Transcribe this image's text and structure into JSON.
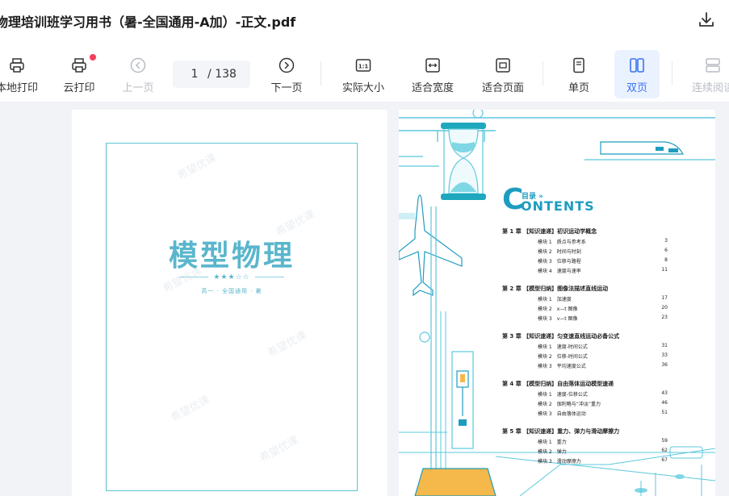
{
  "header": {
    "file_title": "物理培训班学习用书（暑-全国通用-A加）-正文.pdf",
    "download_icon": "download-icon"
  },
  "toolbar": {
    "local_print": "本地打印",
    "cloud_print": "云打印",
    "prev_page": "上一页",
    "current_page": "1",
    "total_pages": "/ 138",
    "next_page": "下一页",
    "actual_size": "实际大小",
    "fit_width": "适合宽度",
    "fit_page": "适合页面",
    "single_page": "单页",
    "double_page": "双页",
    "continuous": "连续阅读",
    "accent_color": "#3a73f0",
    "badge_color": "#f43e5a"
  },
  "cover": {
    "title": "模型物理",
    "stars": "★★★☆☆",
    "subtitle": "高一 · 全国通用 · 暑",
    "watermark": "希望优课"
  },
  "contents": {
    "big_letter": "C",
    "mulu": "目录 »",
    "word": "ONTENTS",
    "chapters": [
      {
        "title": "第 1 章 【知识速递】初识运动学概念",
        "modules": [
          {
            "name": "模块 1　质点与参考系",
            "page": "3"
          },
          {
            "name": "模块 2　时间与时刻",
            "page": "6"
          },
          {
            "name": "模块 3　位移与路程",
            "page": "8"
          },
          {
            "name": "模块 4　速度与速率",
            "page": "11"
          }
        ]
      },
      {
        "title": "第 2 章 【模型归纳】图像法描述直线运动",
        "modules": [
          {
            "name": "模块 1　加速度",
            "page": "17"
          },
          {
            "name": "模块 2　x—t 图像",
            "page": "20"
          },
          {
            "name": "模块 3　v—t 图像",
            "page": "23"
          }
        ]
      },
      {
        "title": "第 3 章 【知识速递】匀变速直线运动必备公式",
        "modules": [
          {
            "name": "模块 1　速度-时间公式",
            "page": "31"
          },
          {
            "name": "模块 2　位移-时间公式",
            "page": "33"
          },
          {
            "name": "模块 3　平均速度公式",
            "page": "36"
          }
        ]
      },
      {
        "title": "第 4 章 【模型归纳】自由落体运动模型速递",
        "modules": [
          {
            "name": "模块 1　速度-位移公式",
            "page": "43"
          },
          {
            "name": "模块 2　伽利略与“冲淡”重力",
            "page": "46"
          },
          {
            "name": "模块 3　自由落体运动",
            "page": "51"
          }
        ]
      },
      {
        "title": "第 5 章 【知识速递】重力、弹力与滑动摩擦力",
        "modules": [
          {
            "name": "模块 1　重力",
            "page": "59"
          },
          {
            "name": "模块 2　弹力",
            "page": "62"
          },
          {
            "name": "模块 3　滑动摩擦力",
            "page": "67"
          }
        ]
      }
    ]
  }
}
